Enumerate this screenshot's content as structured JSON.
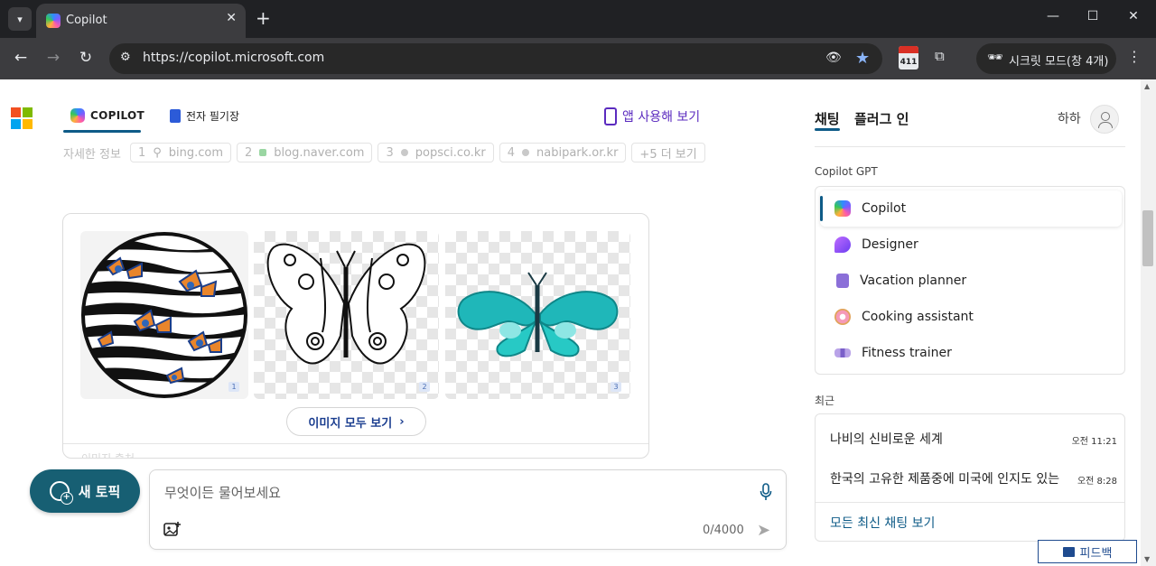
{
  "browser": {
    "tab_title": "Copilot",
    "url": "https://copilot.microsoft.com",
    "profile_label": "시크릿 모드(창 4개)",
    "extension_badge": "411"
  },
  "header": {
    "nav_copilot": "COPILOT",
    "nav_notebook": "전자 필기장",
    "app_link": "앱 사용해 보기"
  },
  "references": {
    "label": "자세한 정보",
    "items": [
      {
        "num": "1",
        "site": "bing.com"
      },
      {
        "num": "2",
        "site": "blog.naver.com"
      },
      {
        "num": "3",
        "site": "popsci.co.kr"
      },
      {
        "num": "4",
        "site": "nabipark.or.kr"
      }
    ],
    "more": "+5 더 보기"
  },
  "images": {
    "badges": [
      "1",
      "2",
      "3"
    ],
    "show_all": "이미지 모두 보기",
    "faded_label": "이미지 출처"
  },
  "composer": {
    "new_topic": "새 토픽",
    "placeholder": "무엇이든 물어보세요",
    "char_count": "0/4000"
  },
  "right_panel": {
    "tab_chat": "채팅",
    "tab_plugins": "플러그 인",
    "user_name": "하하",
    "gpt_section": "Copilot GPT",
    "gpts": [
      {
        "label": "Copilot",
        "icon": "copilot-icon"
      },
      {
        "label": "Designer",
        "icon": "designer-icon"
      },
      {
        "label": "Vacation planner",
        "icon": "suitcase-icon"
      },
      {
        "label": "Cooking assistant",
        "icon": "donut-icon"
      },
      {
        "label": "Fitness trainer",
        "icon": "dumbbell-icon"
      }
    ],
    "recent_section": "최근",
    "recent": [
      {
        "title": "나비의 신비로운 세계",
        "time": "오전 11:21"
      },
      {
        "title": "한국의 고유한 제품중에 미국에 인지도 있는 제품",
        "time": "오전 8:28"
      }
    ],
    "see_all": "모든 최신 채팅 보기",
    "feedback": "피드백"
  },
  "colors": {
    "accent": "#0e5b87",
    "new_topic_bg": "#175f73",
    "chrome_dark": "#202124"
  }
}
